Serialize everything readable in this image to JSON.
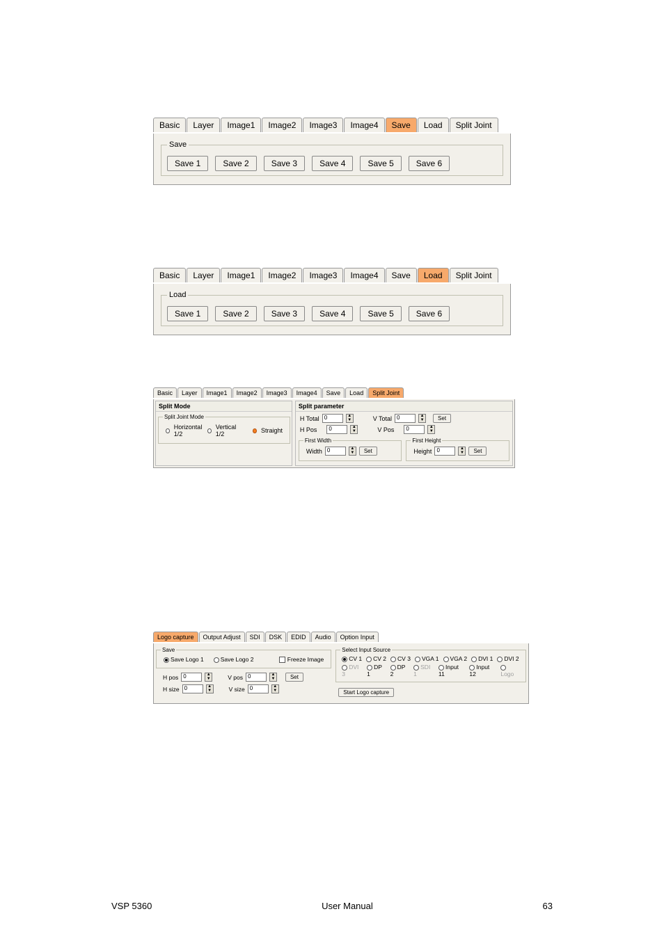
{
  "tabs_common": [
    "Basic",
    "Layer",
    "Image1",
    "Image2",
    "Image3",
    "Image4",
    "Save",
    "Load",
    "Split Joint"
  ],
  "save_panel": {
    "legend": "Save",
    "buttons": [
      "Save 1",
      "Save 2",
      "Save 3",
      "Save 4",
      "Save 5",
      "Save 6"
    ]
  },
  "load_panel": {
    "legend": "Load",
    "buttons": [
      "Save 1",
      "Save 2",
      "Save 3",
      "Save 4",
      "Save 5",
      "Save 6"
    ]
  },
  "split_joint": {
    "left_hdr": "Split Mode",
    "left_fieldset": "Split Joint Mode",
    "opt_h": "Horizontal 1/2",
    "opt_v": "Vertical 1/2",
    "opt_s": "Straight",
    "right_hdr": "Split parameter",
    "htotal": "H Total",
    "vtotal": "V Total",
    "hpos": "H Pos",
    "vpos": "V Pos",
    "set": "Set",
    "fw_legend": "First Width",
    "fh_legend": "First Height",
    "width": "Width",
    "height": "Height",
    "zero": "0"
  },
  "logo": {
    "tabs": [
      "Logo capture",
      "Output Adjust",
      "SDI",
      "DSK",
      "EDID",
      "Audio",
      "Option Input"
    ],
    "save_legend": "Save",
    "save_logo1": "Save Logo 1",
    "save_logo2": "Save Logo 2",
    "freeze": "Freeze Image",
    "hpos": "H pos",
    "vpos": "V pos",
    "hsize": "H size",
    "vsize": "V size",
    "set": "Set",
    "zero": "0",
    "sel_legend": "Select Input Source",
    "row1": [
      "CV 1",
      "CV 2",
      "CV 3",
      "VGA 1",
      "VGA 2",
      "DVI 1",
      "DVI 2"
    ],
    "row2": [
      "DVI 3",
      "DP 1",
      "DP 2",
      "SDI 1",
      "Input 11",
      "Input 12",
      "Logo"
    ],
    "start": "Start Logo capture"
  },
  "footer": {
    "left": "VSP 5360",
    "center": "User Manual",
    "right": "63"
  }
}
